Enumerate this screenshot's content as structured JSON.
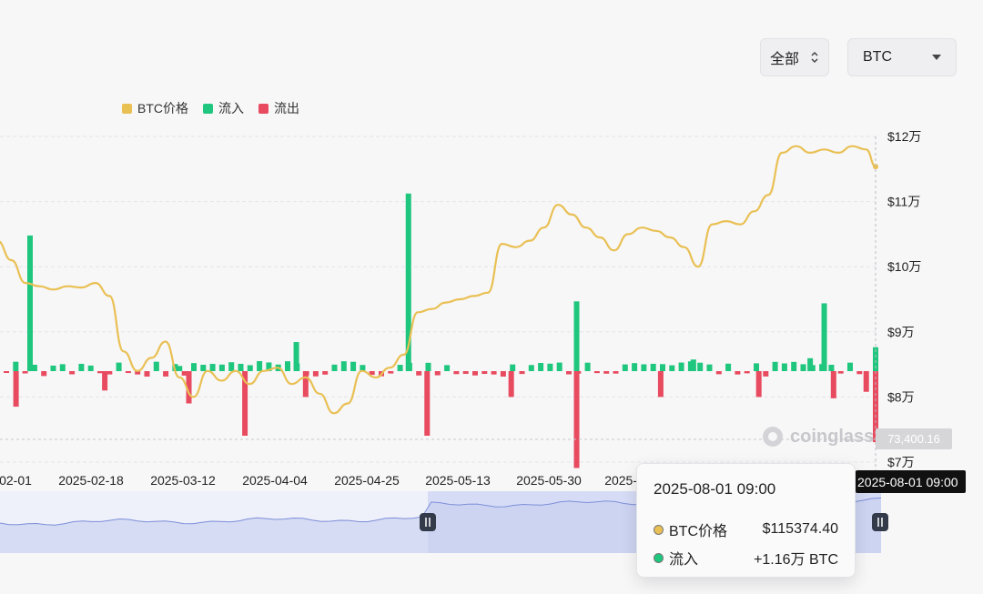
{
  "controls": {
    "range_label": "全部",
    "coin_label": "BTC"
  },
  "legend": [
    {
      "label": "BTC价格",
      "color": "#e9c054"
    },
    {
      "label": "流入",
      "color": "#1fc67d"
    },
    {
      "label": "流出",
      "color": "#e84a5f"
    }
  ],
  "watermark": "coinglass",
  "tooltip": {
    "date": "2025-08-01 09:00",
    "rows": [
      {
        "label": "BTC价格",
        "value": "$115374.40",
        "color": "#e9c054"
      },
      {
        "label": "流入",
        "value": "+1.16万 BTC",
        "color": "#1fc67d"
      }
    ]
  },
  "crosshair": {
    "x_label": "2025-08-01 09:00",
    "y_label": "73,400.16"
  },
  "chart_data": {
    "type": "line",
    "x_tick_labels": [
      "02-01",
      "2025-02-18",
      "2025-03-12",
      "2025-04-04",
      "2025-04-25",
      "2025-05-13",
      "2025-05-30",
      "2025-06-18"
    ],
    "y_tick_labels": [
      "$12万",
      "$11万",
      "$10万",
      "$9万",
      "$8万",
      "$7万"
    ],
    "ylim": [
      70000,
      120000
    ],
    "grid": true,
    "legend_position": "top-left",
    "series": [
      {
        "name": "BTC价格",
        "color": "#e9c054",
        "x": [
          "2025-01-25",
          "2025-01-28",
          "2025-01-31",
          "2025-02-03",
          "2025-02-06",
          "2025-02-09",
          "2025-02-12",
          "2025-02-15",
          "2025-02-18",
          "2025-02-21",
          "2025-02-24",
          "2025-02-27",
          "2025-03-02",
          "2025-03-05",
          "2025-03-08",
          "2025-03-11",
          "2025-03-14",
          "2025-03-17",
          "2025-03-20",
          "2025-03-23",
          "2025-03-26",
          "2025-03-29",
          "2025-04-01",
          "2025-04-04",
          "2025-04-07",
          "2025-04-10",
          "2025-04-13",
          "2025-04-16",
          "2025-04-19",
          "2025-04-22",
          "2025-04-25",
          "2025-04-28",
          "2025-05-01",
          "2025-05-04",
          "2025-05-07",
          "2025-05-10",
          "2025-05-13",
          "2025-05-16",
          "2025-05-19",
          "2025-05-22",
          "2025-05-25",
          "2025-05-28",
          "2025-05-31",
          "2025-06-03",
          "2025-06-06",
          "2025-06-09",
          "2025-06-12",
          "2025-06-15",
          "2025-06-18",
          "2025-06-21",
          "2025-06-24",
          "2025-06-27",
          "2025-06-30",
          "2025-07-03",
          "2025-07-06",
          "2025-07-09",
          "2025-07-12",
          "2025-07-15",
          "2025-07-18",
          "2025-07-21",
          "2025-07-24",
          "2025-07-27",
          "2025-07-30",
          "2025-08-01"
        ],
        "values": [
          104000,
          101000,
          97500,
          97000,
          96500,
          97000,
          96800,
          97500,
          95500,
          87000,
          84000,
          86000,
          88500,
          83000,
          80000,
          84000,
          82500,
          84000,
          82000,
          84000,
          84500,
          82000,
          83000,
          80500,
          77500,
          79000,
          84000,
          83000,
          84500,
          86500,
          93000,
          93500,
          94500,
          95000,
          95500,
          96000,
          103500,
          103000,
          104000,
          106000,
          109500,
          108000,
          106000,
          104500,
          102500,
          105000,
          106000,
          105500,
          104500,
          103000,
          100000,
          106500,
          107000,
          106500,
          108500,
          111000,
          117500,
          118500,
          117500,
          118000,
          117500,
          118500,
          118000,
          115374
        ]
      },
      {
        "name": "流入",
        "color": "#1fc67d",
        "x": [
          "2025-02-01",
          "2025-03-05",
          "2025-03-30",
          "2025-04-23",
          "2025-05-29",
          "2025-06-23",
          "2025-07-18",
          "2025-07-21",
          "2025-08-01"
        ],
        "values": [
          21000,
          800,
          4500,
          27500,
          10800,
          1800,
          2000,
          10500,
          3700
        ]
      },
      {
        "name": "流出",
        "color": "#e84a5f",
        "x": [
          "2025-01-29",
          "2025-02-17",
          "2025-03-07",
          "2025-03-19",
          "2025-04-01",
          "2025-04-27",
          "2025-05-15",
          "2025-05-29",
          "2025-06-16",
          "2025-07-07",
          "2025-07-23",
          "2025-07-30",
          "2025-08-01"
        ],
        "values": [
          -5500,
          -3000,
          -5000,
          -10000,
          -4000,
          -10000,
          -4000,
          -15000,
          -4000,
          -4000,
          -4200,
          -3200,
          -11000
        ]
      }
    ]
  }
}
